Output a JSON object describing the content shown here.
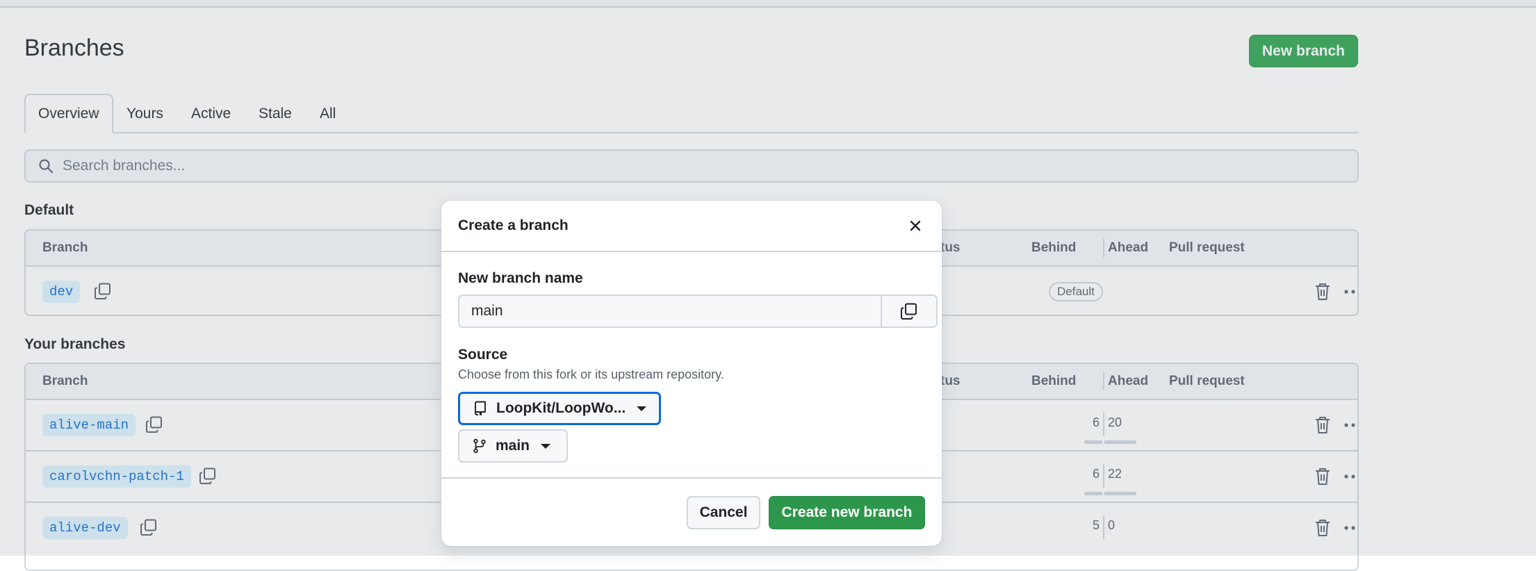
{
  "page": {
    "title": "Branches",
    "new_branch_label": "New branch",
    "tabs": [
      "Overview",
      "Yours",
      "Active",
      "Stale",
      "All"
    ],
    "search_placeholder": "Search branches..."
  },
  "default_section": {
    "title": "Default",
    "headers": {
      "branch": "Branch",
      "status": "tus",
      "behind": "Behind",
      "ahead": "Ahead",
      "pull_request": "Pull request"
    },
    "rows": [
      {
        "name": "dev",
        "badge": "Default"
      }
    ]
  },
  "your_section": {
    "title": "Your branches",
    "headers": {
      "branch": "Branch",
      "status": "tus",
      "behind": "Behind",
      "ahead": "Ahead",
      "pull_request": "Pull request"
    },
    "rows": [
      {
        "name": "alive-main",
        "behind": "6",
        "ahead": "20"
      },
      {
        "name": "carolvchn-patch-1",
        "behind": "6",
        "ahead": "22"
      },
      {
        "name": "alive-dev",
        "behind": "5",
        "ahead": "0"
      }
    ]
  },
  "dialog": {
    "title": "Create a branch",
    "name_label": "New branch name",
    "name_value": "main",
    "source_label": "Source",
    "source_hint": "Choose from this fork or its upstream repository.",
    "repo_select": "LoopKit/LoopWo...",
    "branch_select": "main",
    "cancel_label": "Cancel",
    "create_label": "Create new branch"
  },
  "colors": {
    "accent_green": "#2da44e",
    "link_blue": "#0969da",
    "border": "#d0d7de"
  }
}
